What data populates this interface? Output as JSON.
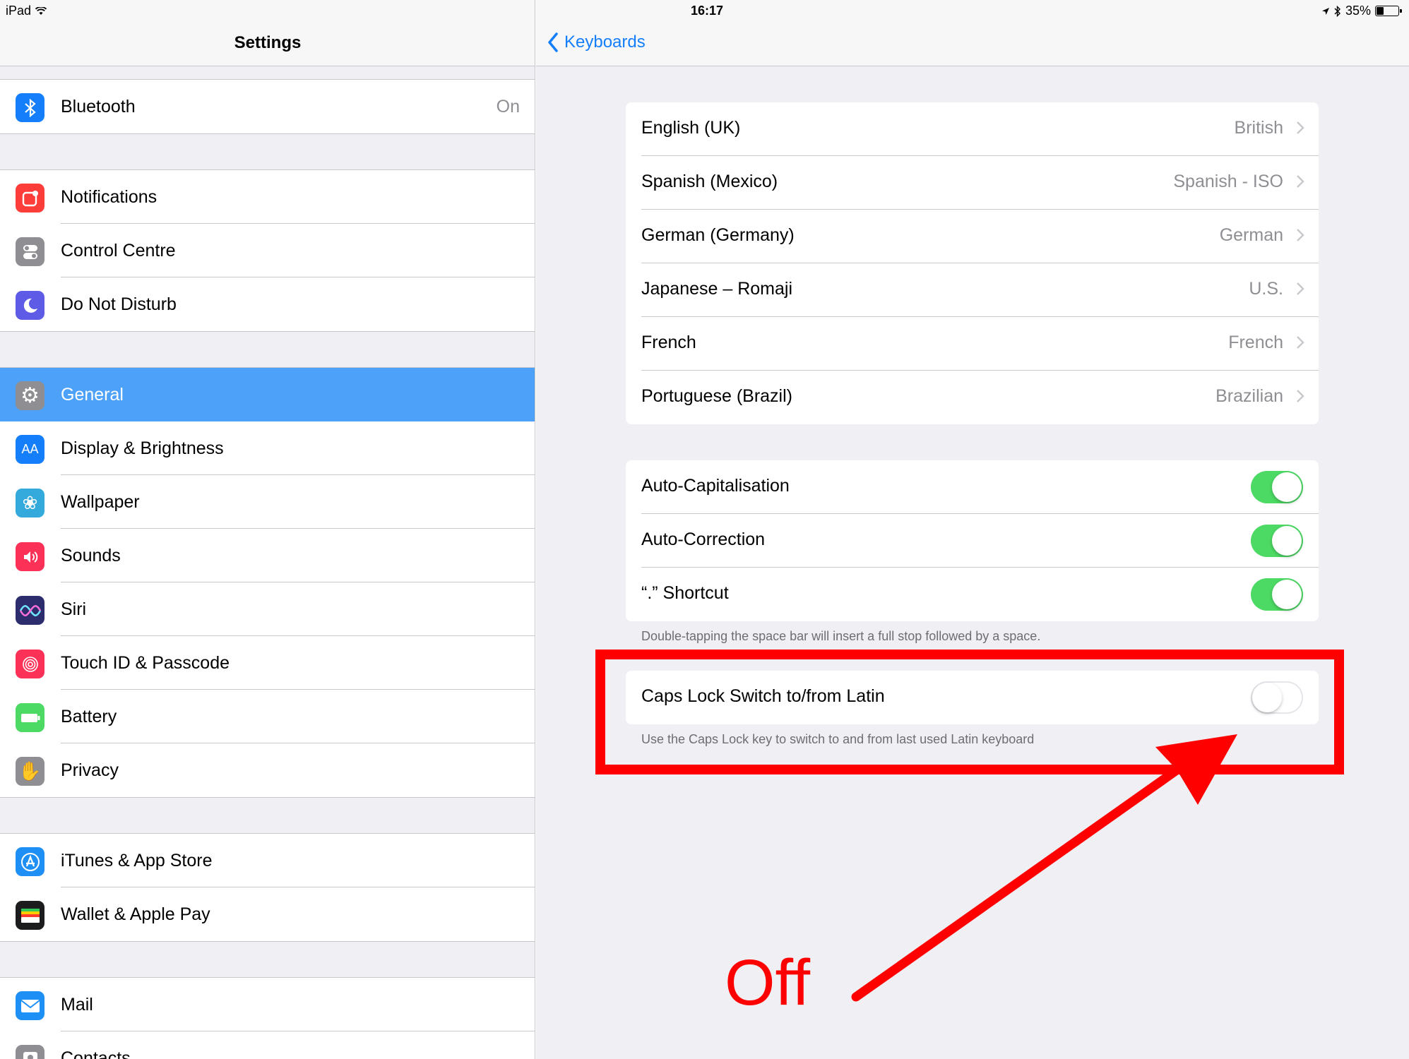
{
  "status_bar": {
    "device": "iPad",
    "time": "16:17",
    "battery": "35%",
    "battery_level": 0.35
  },
  "left": {
    "title": "Settings",
    "groups": [
      [
        {
          "label": "Bluetooth",
          "value": "On",
          "icon": "bluetooth-icon",
          "color": "#157efb"
        }
      ],
      [
        {
          "label": "Notifications",
          "icon": "notifications-icon",
          "color": "#fc3d39"
        },
        {
          "label": "Control Centre",
          "icon": "control-centre-icon",
          "color": "#8e8e93"
        },
        {
          "label": "Do Not Disturb",
          "icon": "moon-icon",
          "color": "#5e5ce6"
        }
      ],
      [
        {
          "label": "General",
          "icon": "gear-icon",
          "color": "#8e8e93",
          "selected": true
        },
        {
          "label": "Display & Brightness",
          "icon": "display-icon",
          "color": "#157efb"
        },
        {
          "label": "Wallpaper",
          "icon": "wallpaper-icon",
          "color": "#34aadc"
        },
        {
          "label": "Sounds",
          "icon": "speaker-icon",
          "color": "#fc3158"
        },
        {
          "label": "Siri",
          "icon": "siri-icon",
          "color": "#2d2d6e"
        },
        {
          "label": "Touch ID & Passcode",
          "icon": "fingerprint-icon",
          "color": "#fc3158"
        },
        {
          "label": "Battery",
          "icon": "battery-icon",
          "color": "#4cd964"
        },
        {
          "label": "Privacy",
          "icon": "hand-icon",
          "color": "#8e8e93"
        }
      ],
      [
        {
          "label": "iTunes & App Store",
          "icon": "app-store-icon",
          "color": "#1e8ff4"
        },
        {
          "label": "Wallet & Apple Pay",
          "icon": "wallet-icon",
          "color": "#1c1c1e"
        }
      ],
      [
        {
          "label": "Mail",
          "icon": "mail-icon",
          "color": "#1e8ff4"
        },
        {
          "label": "Contacts",
          "icon": "contacts-icon",
          "color": "#8e8e93"
        }
      ]
    ]
  },
  "right": {
    "back_label": "Keyboards",
    "keyboards": [
      {
        "label": "English (UK)",
        "value": "British"
      },
      {
        "label": "Spanish (Mexico)",
        "value": "Spanish - ISO"
      },
      {
        "label": "German (Germany)",
        "value": "German"
      },
      {
        "label": "Japanese – Romaji",
        "value": "U.S."
      },
      {
        "label": "French",
        "value": "French"
      },
      {
        "label": "Portuguese (Brazil)",
        "value": "Brazilian"
      }
    ],
    "toggles": [
      {
        "label": "Auto-Capitalisation",
        "on": true
      },
      {
        "label": "Auto-Correction",
        "on": true
      },
      {
        "label": "“.” Shortcut",
        "on": true
      }
    ],
    "shortcut_note": "Double-tapping the space bar will insert a full stop followed by a space.",
    "caps_lock": {
      "label": "Caps Lock Switch to/from Latin",
      "on": false
    },
    "caps_note": "Use the Caps Lock key to switch to and from last used Latin keyboard"
  },
  "annotation": {
    "text": "Off",
    "color": "#ff0000"
  }
}
